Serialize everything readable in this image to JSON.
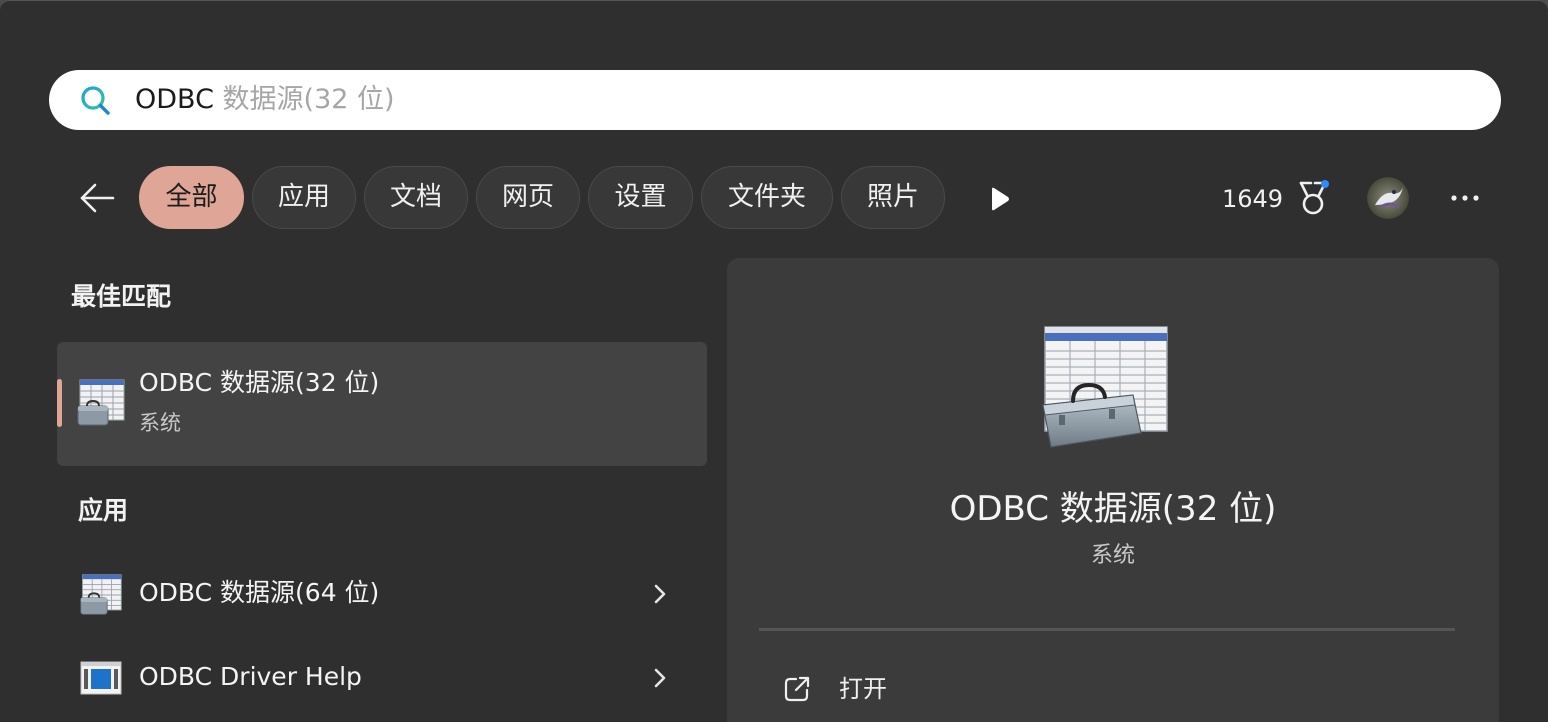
{
  "search": {
    "typed": "ODBC",
    "suggestion": " 数据源(32 位)",
    "icon": "search-icon"
  },
  "filters": {
    "back_icon": "back-arrow-icon",
    "chips": [
      "全部",
      "应用",
      "文档",
      "网页",
      "设置",
      "文件夹",
      "照片"
    ],
    "active_chip": "全部",
    "more_filters_icon": "play-icon"
  },
  "header_right": {
    "points": "1649",
    "medal_icon": "medal-icon",
    "more_icon": "ellipsis-icon"
  },
  "best_match": {
    "heading": "最佳匹配",
    "title": "ODBC 数据源(32 位)",
    "subtitle": "系统",
    "icon": "toolbox-table-icon"
  },
  "apps": {
    "heading": "应用",
    "items": [
      {
        "title": "ODBC 数据源(64 位)",
        "icon": "toolbox-table-icon"
      },
      {
        "title": "ODBC Driver Help",
        "icon": "help-book-icon"
      }
    ]
  },
  "preview": {
    "title": "ODBC 数据源(32 位)",
    "subtitle": "系统",
    "actions": [
      {
        "label": "打开",
        "icon": "open-external-icon"
      }
    ]
  },
  "colors": {
    "background": "#2f2f2f",
    "panel": "#3b3b3b",
    "accent": "#dfa596",
    "search_bg": "#ffffff"
  }
}
